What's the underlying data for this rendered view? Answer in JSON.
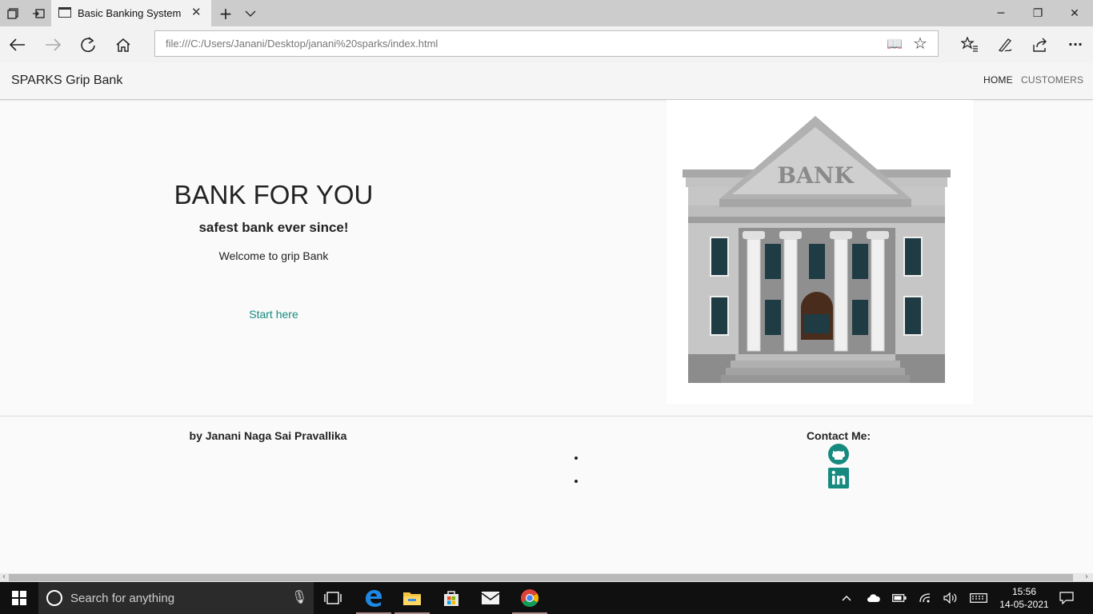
{
  "browser": {
    "tab_title": "Basic Banking System",
    "tab_close": "✕",
    "new_tab": "+",
    "tab_list": "⌵",
    "address": "file:///C:/Users/Janani/Desktop/janani%20sparks/index.html",
    "window_controls": {
      "minimize": "─",
      "restore": "❐",
      "close": "✕"
    },
    "more": "···"
  },
  "site": {
    "brand": "SPARKS Grip Bank",
    "nav": [
      {
        "label": "HOME",
        "color": "#222222"
      },
      {
        "label": "CUSTOMERS",
        "color": "#666666"
      }
    ],
    "hero": {
      "title": "BANK FOR YOU",
      "subtitle": "safest bank ever since!",
      "welcome": "Welcome to grip Bank",
      "cta": "Start here"
    },
    "image": {
      "sign": "BANK"
    },
    "footer": {
      "author": "by Janani Naga Sai Pravallika",
      "contact_title": "Contact Me:",
      "icons": [
        "github-icon",
        "linkedin-icon"
      ]
    }
  },
  "taskbar": {
    "search_placeholder": "Search for anything",
    "apps": [
      "task-view-icon",
      "edge-icon",
      "file-explorer-icon",
      "store-icon",
      "mail-icon",
      "chrome-icon"
    ],
    "time": "15:56",
    "date": "14-05-2021"
  },
  "colors": {
    "accent": "#168a7f",
    "taskbar": "#101010"
  }
}
